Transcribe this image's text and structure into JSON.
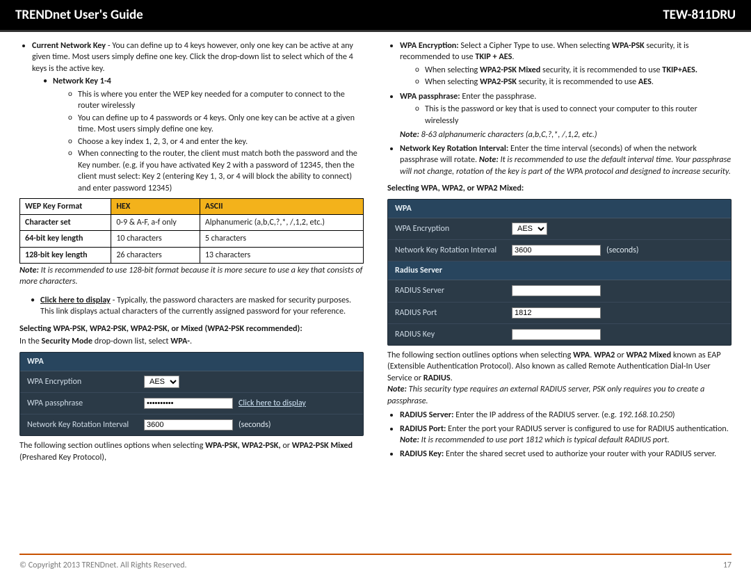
{
  "header": {
    "title": "TRENDnet User's Guide",
    "model": "TEW-811DRU"
  },
  "left": {
    "current_key_label": "Current Network Key",
    "current_key_text": " - You can define up to 4 keys however, only one key can be active at any given time. Most users simply define one key. Click the drop-down list to select which of the 4 keys is the active key.",
    "nk_label": "Network Key 1-4",
    "nk_items": [
      "This is where you enter the WEP key needed for a computer to connect to the router wirelessly",
      "You can define up to 4 passwords or 4 keys. Only one key can be active at a given time. Most users simply define one key.",
      "Choose a key index 1, 2, 3, or 4 and enter the key.",
      "When connecting to the router, the client must match both the password and the Key number. (e.g. if you have activated Key 2 with a password of 12345, then the client must select: Key 2 (entering Key 1, 3, or 4 will block the ability to connect) and enter password 12345)"
    ],
    "table": {
      "h0": "WEP Key Format",
      "h1": "HEX",
      "h2": "ASCII",
      "r1": {
        "a": "Character set",
        "b": "0-9 & A-F, a-f only",
        "c": "Alphanumeric (a,b,C,?,*, /,1,2, etc.)"
      },
      "r2": {
        "a": "64-bit key length",
        "b": "10 characters",
        "c": "5 characters"
      },
      "r3": {
        "a": "128-bit key length",
        "b": "26 characters",
        "c": "13 characters"
      }
    },
    "note1_pre": "Note:",
    "note1": " It is recommended to use 128-bit format because it is more secure to use a key that consists of more characters.",
    "click_label": "Click here to display",
    "click_text": " -  Typically, the password characters are masked for security purposes. This link displays actual characters of the currently assigned password for your reference.",
    "sel_hdr": "Selecting WPA-PSK, WPA2-PSK, WPA2-PSK, or Mixed (WPA2-PSK recommended):",
    "sel_line_a": "In the ",
    "sel_line_b": "Security Mode",
    "sel_line_c": " drop-down list, select ",
    "sel_line_d": "WPA-",
    "sel_line_e": ".",
    "router1": {
      "section": "WPA",
      "enc_label": "WPA Encryption",
      "enc_value": "AES",
      "pass_label": "WPA passphrase",
      "pass_value": "••••••••••",
      "pass_link": "Click here to display",
      "rot_label": "Network Key Rotation Interval",
      "rot_value": "3600",
      "rot_unit": "(seconds)"
    },
    "tail_a": "The following section outlines options when selecting ",
    "tail_b": "WPA-PSK, WPA2-PSK,",
    "tail_c": " or ",
    "tail_d": "WPA2-PSK Mixed ",
    "tail_e": "(Preshared Key Protocol),"
  },
  "right": {
    "enc_label": "WPA Encryption:",
    "enc_text": " Select a Cipher Type to use. When selecting ",
    "enc_b1": "WPA-PSK",
    "enc_text2": " security, it is recommended to use ",
    "enc_b2": "TKIP + AES",
    "enc_text3": ".",
    "enc_sub1a": "When selecting ",
    "enc_sub1b": "WPA2-PSK Mixed",
    "enc_sub1c": " security, it is recommended to use ",
    "enc_sub1d": "TKIP+AES.",
    "enc_sub2a": "When selecting ",
    "enc_sub2b": "WPA2-PSK",
    "enc_sub2c": " security, it is recommended to use ",
    "enc_sub2d": "AES",
    "enc_sub2e": ".",
    "pp_label": "WPA passphrase:",
    "pp_text": " Enter the passphrase.",
    "pp_sub": "This is the password or key that is used to connect your computer to this router wirelessly",
    "pp_note_pre": "Note:",
    "pp_note": " 8-63 alphanumeric characters (a,b,C,?,*, /,1,2, etc.)",
    "rot_label": "Network Key Rotation Interval:",
    "rot_text": " Enter the time interval (seconds) of when the network passphrase will rotate. ",
    "rot_note_pre": "Note:",
    "rot_note": " It is recommended to use the default interval time. Your passphrase will not change, rotation of the key is part of the WPA protocol and designed to increase security.",
    "sel2": "Selecting WPA, WPA2, or WPA2 Mixed:",
    "router2": {
      "section": "WPA",
      "enc_label": "WPA Encryption",
      "enc_value": "AES",
      "rot_label": "Network Key Rotation Interval",
      "rot_value": "3600",
      "rot_unit": "(seconds)",
      "rad_section": "Radius Server",
      "rs_label": "RADIUS Server",
      "rs_value": "",
      "rp_label": "RADIUS Port",
      "rp_value": "1812",
      "rk_label": "RADIUS Key",
      "rk_value": ""
    },
    "post_a": "The following section outlines options when selecting ",
    "post_b": "WPA",
    "post_c": ". ",
    "post_d": "WPA2",
    "post_e": " or ",
    "post_f": "WPA2 Mixed",
    "post_g": " known as EAP (Extensible Authentication Protocol). Also known as called Remote Authentication Dial-In User Service or ",
    "post_h": "RADIUS",
    "post_i": ".",
    "post_note_pre": "Note:",
    "post_note": " This security type requires an external RADIUS server, PSK only requires you to create a passphrase.",
    "rs_b": "RADIUS Server:",
    "rs_t": " Enter the IP address of the RADIUS server. (e.g. ",
    "rs_ex": "192.168.10.250",
    "rs_t2": ")",
    "rp_b": "RADIUS Port:",
    "rp_t": " Enter the port your RADIUS server is configured to use for RADIUS authentication.",
    "rp_note_pre": "Note:",
    "rp_note": " It is recommended to use port 1812 which is typical default RADIUS port.",
    "rk_b": "RADIUS Key:",
    "rk_t": " Enter the shared secret used to authorize your router with your RADIUS server."
  },
  "footer": {
    "copy": "© Copyright 2013 TRENDnet. All Rights Reserved.",
    "page": "17"
  }
}
